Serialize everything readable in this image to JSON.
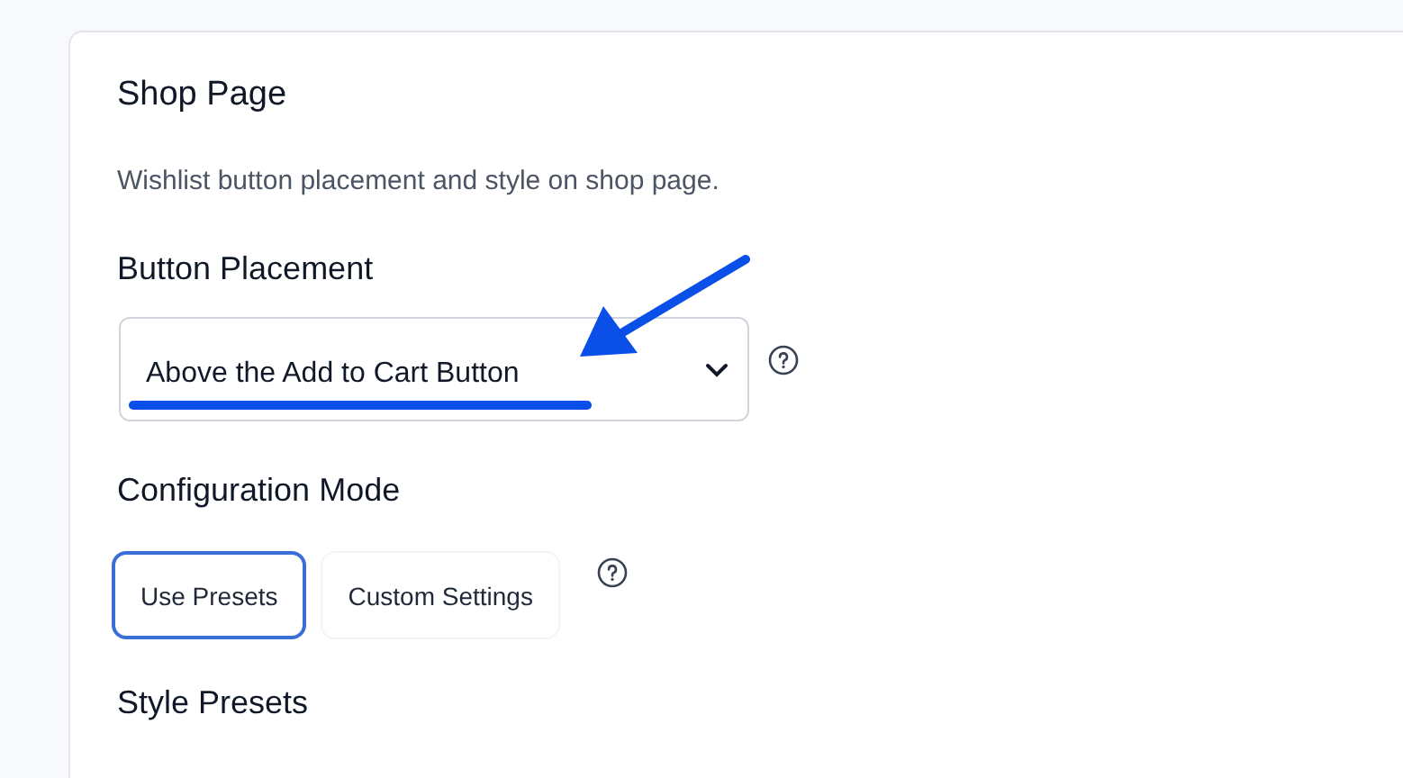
{
  "section": {
    "title": "Shop Page",
    "description": "Wishlist button placement and style on shop page."
  },
  "placement": {
    "label": "Button Placement",
    "value": "Above the Add to Cart Button"
  },
  "configuration_mode": {
    "label": "Configuration Mode",
    "options": [
      {
        "label": "Use Presets",
        "selected": true
      },
      {
        "label": "Custom Settings",
        "selected": false
      }
    ]
  },
  "style_presets": {
    "label": "Style Presets"
  }
}
